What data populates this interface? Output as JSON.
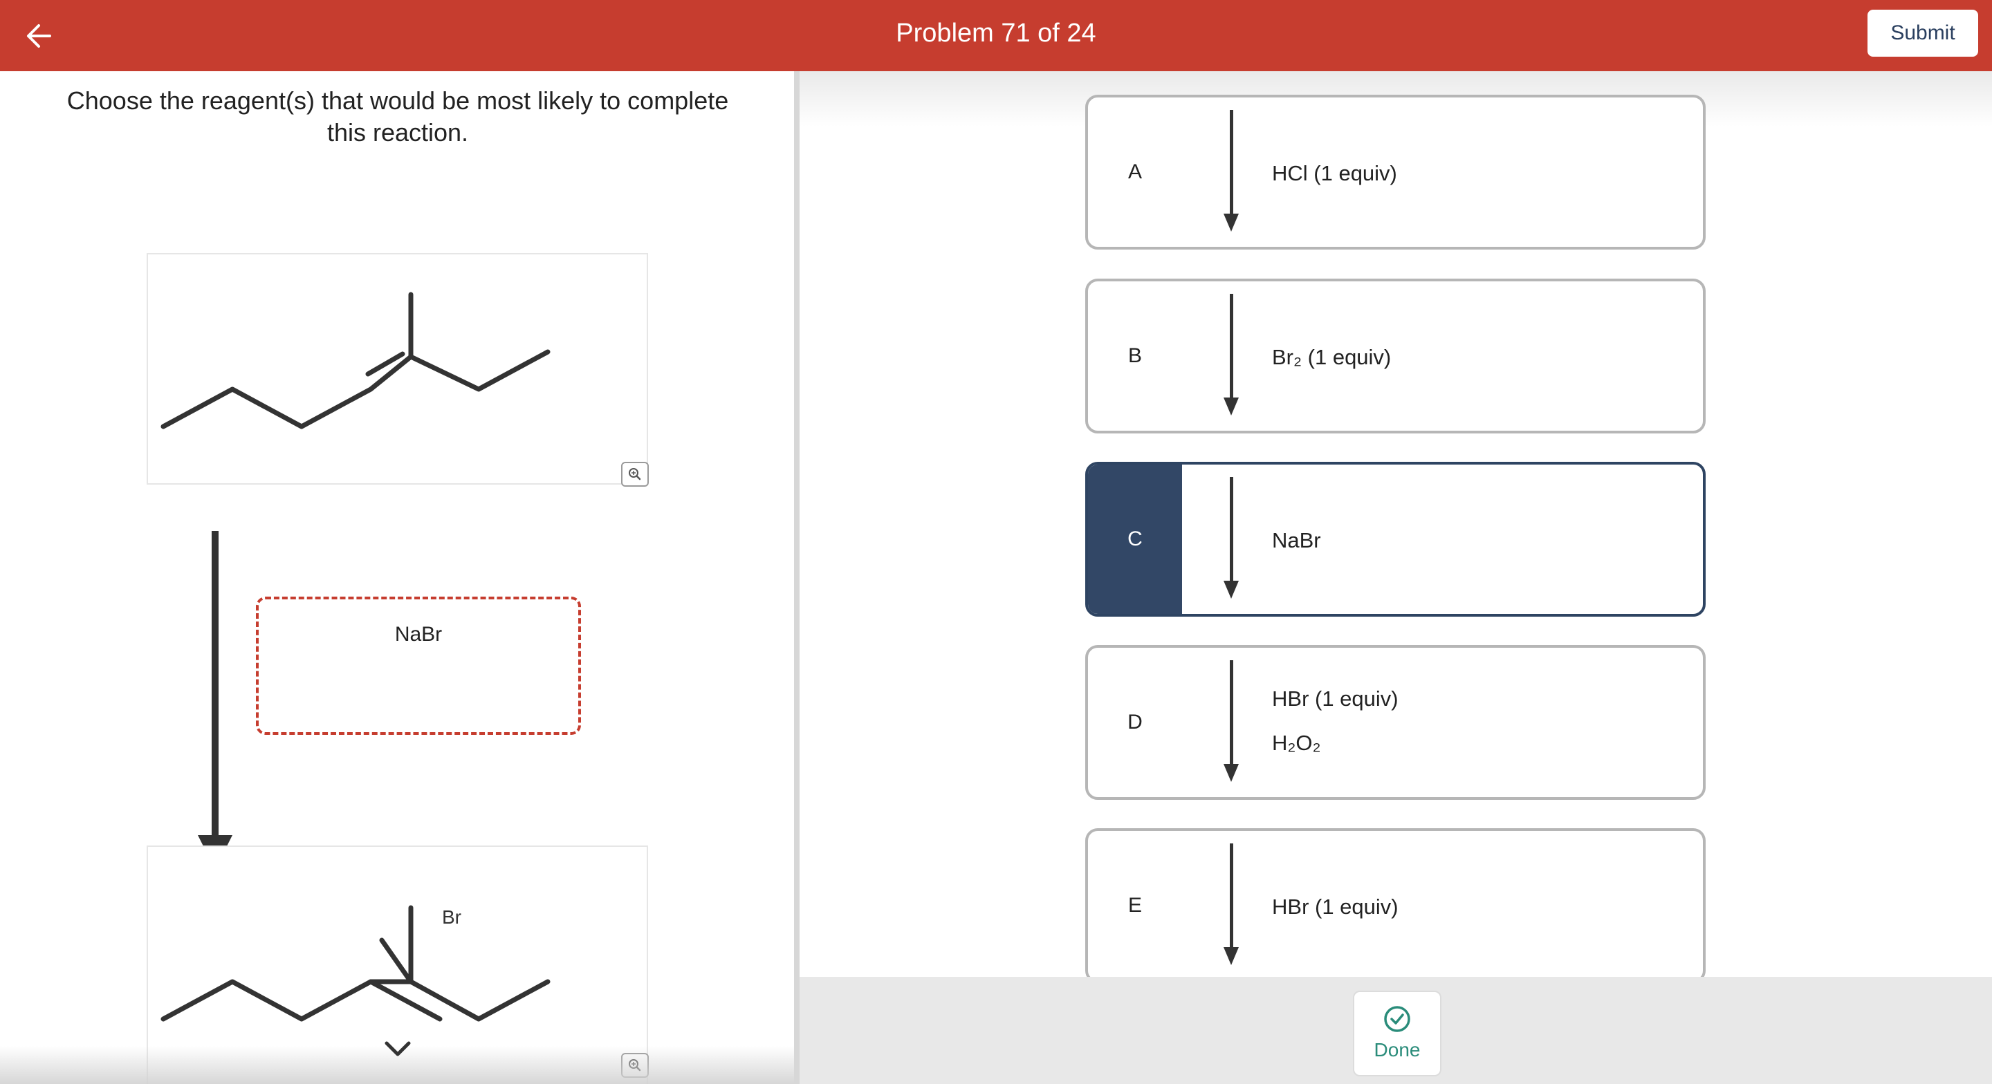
{
  "header": {
    "title": "Problem 71 of 24",
    "submit_label": "Submit"
  },
  "question": {
    "prompt": "Choose the reagent(s) that would be most likely to complete this reaction.",
    "reagent_in_dropzone": "NaBr",
    "product_substituent_label": "Br"
  },
  "options": [
    {
      "letter": "A",
      "reagents": [
        "HCl (1 equiv)"
      ],
      "selected": false
    },
    {
      "letter": "B",
      "reagents": [
        "Br₂ (1 equiv)"
      ],
      "selected": false
    },
    {
      "letter": "C",
      "reagents": [
        "NaBr"
      ],
      "selected": true
    },
    {
      "letter": "D",
      "reagents": [
        "HBr (1 equiv)",
        "H₂O₂"
      ],
      "selected": false
    },
    {
      "letter": "E",
      "reagents": [
        "HBr (1 equiv)"
      ],
      "selected": false
    }
  ],
  "done": {
    "label": "Done"
  },
  "colors": {
    "header_bg": "#c63d2f",
    "selected_bg": "#324766",
    "done_accent": "#2a8c7a",
    "dropzone_border": "#c63d2f"
  },
  "icons": {
    "back": "arrow-left-icon",
    "zoom": "zoom-in-icon",
    "scroll_up": "chevron-up-icon",
    "scroll_down": "chevron-down-icon",
    "done": "check-circle-icon"
  }
}
